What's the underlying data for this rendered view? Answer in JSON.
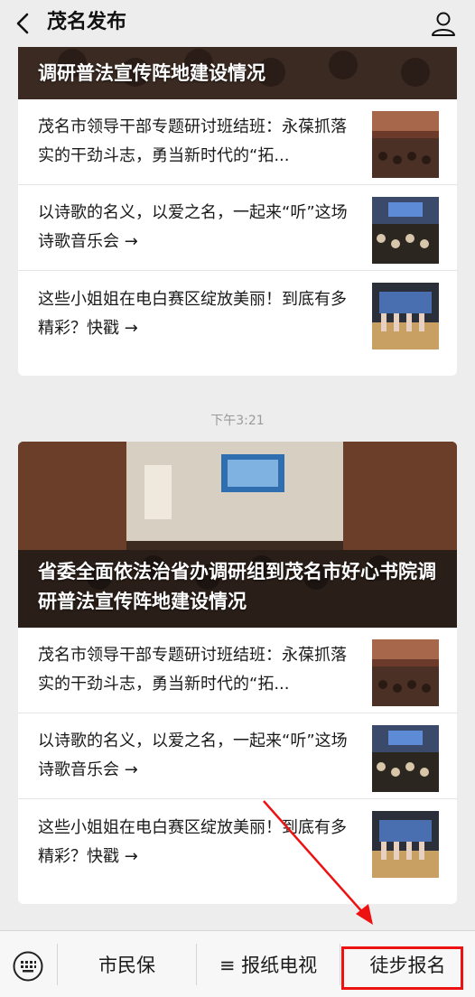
{
  "header": {
    "title": "茂名发布"
  },
  "feed": {
    "card1": {
      "cover_title": "调研普法宣传阵地建设情况",
      "items": [
        {
          "text": "茂名市领导干部专题研讨班结班：永葆抓落实的干劲斗志，勇当新时代的“拓..."
        },
        {
          "text": "以诗歌的名义，以爱之名，一起来“听”这场诗歌音乐会 →"
        },
        {
          "text": "这些小姐姐在电白赛区绽放美丽！到底有多精彩？快戳 →"
        }
      ]
    },
    "timestamp": "下午3:21",
    "card2": {
      "cover_title": "省委全面依法治省办调研组到茂名市好心书院调研普法宣传阵地建设情况",
      "items": [
        {
          "text": "茂名市领导干部专题研讨班结班：永葆抓落实的干劲斗志，勇当新时代的“拓..."
        },
        {
          "text": "以诗歌的名义，以爱之名，一起来“听”这场诗歌音乐会 →"
        },
        {
          "text": "这些小姐姐在电白赛区绽放美丽！到底有多精彩？快戳 →"
        }
      ]
    }
  },
  "bottom_menu": {
    "item1": "市民保",
    "item2": "≡ 报纸电视",
    "item3": "徒步报名"
  },
  "icons": {
    "back": "back-arrow-icon",
    "user": "user-profile-icon",
    "keyboard": "keyboard-icon"
  },
  "colors": {
    "highlight": "#ee1111",
    "background": "#ededed"
  }
}
